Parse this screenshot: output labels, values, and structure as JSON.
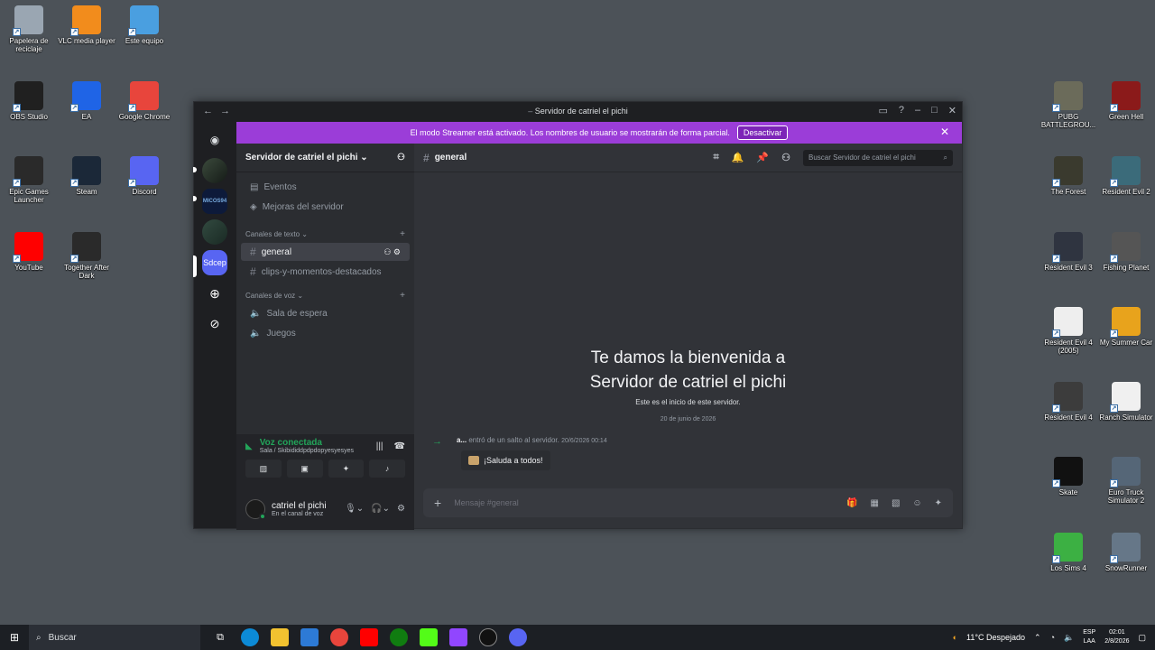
{
  "desktop": {
    "left_icons": [
      {
        "label": "Papelera de reciclaje",
        "icon": "recycle-bin-icon",
        "color": "#9aa6b2"
      },
      {
        "label": "VLC media player",
        "icon": "vlc-icon",
        "color": "#f28c1c"
      },
      {
        "label": "Este equipo",
        "icon": "computer-icon",
        "color": "#4a9fe0"
      },
      {
        "label": "OBS Studio",
        "icon": "obs-icon",
        "color": "#202020"
      },
      {
        "label": "EA",
        "icon": "ea-icon",
        "color": "#1f64e6"
      },
      {
        "label": "Google Chrome",
        "icon": "chrome-icon",
        "color": "#e8453c"
      },
      {
        "label": "Epic Games Launcher",
        "icon": "epic-icon",
        "color": "#2a2a2a"
      },
      {
        "label": "Steam",
        "icon": "steam-icon",
        "color": "#1b2838"
      },
      {
        "label": "Discord",
        "icon": "discord-icon",
        "color": "#5865f2"
      },
      {
        "label": "YouTube",
        "icon": "youtube-icon",
        "color": "#ff0000"
      },
      {
        "label": "Together After Dark",
        "icon": "epic-icon",
        "color": "#2a2a2a"
      }
    ],
    "right_icons": [
      {
        "label": "PUBG BATTLEGROU...",
        "icon": "pubg-icon",
        "color": "#6b6b5a"
      },
      {
        "label": "Green Hell",
        "icon": "green-hell-icon",
        "color": "#8b1a1a"
      },
      {
        "label": "The Forest",
        "icon": "the-forest-icon",
        "color": "#3a3a2e"
      },
      {
        "label": "Resident Evil 2",
        "icon": "re2-icon",
        "color": "#3b6b7a"
      },
      {
        "label": "Resident Evil 3",
        "icon": "re3-icon",
        "color": "#2f3440"
      },
      {
        "label": "Fishing Planet",
        "icon": "fishing-planet-icon",
        "color": "#555"
      },
      {
        "label": "Resident Evil 4 (2005)",
        "icon": "re4-2005-icon",
        "color": "#eee"
      },
      {
        "label": "My Summer Car",
        "icon": "my-summer-car-icon",
        "color": "#e8a31c"
      },
      {
        "label": "Resident Evil 4",
        "icon": "re4-icon",
        "color": "#3c3c3c"
      },
      {
        "label": "Ranch Simulator",
        "icon": "ranch-sim-icon",
        "color": "#f0f0f0"
      },
      {
        "label": "Skate",
        "icon": "skate-icon",
        "color": "#111"
      },
      {
        "label": "Euro Truck Simulator 2",
        "icon": "ets2-icon",
        "color": "#556677"
      },
      {
        "label": "Los Sims 4",
        "icon": "sims-icon",
        "color": "#3cb043"
      },
      {
        "label": "SnowRunner",
        "icon": "snowrunner-icon",
        "color": "#667788"
      }
    ]
  },
  "window": {
    "title": "Servidor de catriel el pichi",
    "streamer_banner": "El modo Streamer está activado. Los nombres de usuario se mostrarán de forma parcial.",
    "streamer_button": "Desactivar",
    "server_initials": "Sdcep",
    "server_label_2": "MICOS94"
  },
  "sidebar": {
    "server_name": "Servidor de catriel el pichi",
    "top_items": [
      {
        "label": "Eventos"
      },
      {
        "label": "Mejoras del servidor"
      }
    ],
    "text_category": "Canales de texto",
    "text_channels": [
      "general",
      "clips-y-momentos-destacados"
    ],
    "voice_category": "Canales de voz",
    "voice_channels": [
      "Sala de espera",
      "Juegos"
    ]
  },
  "voice_panel": {
    "status": "Voz conectada",
    "room": "Sala / Skibididdpdpdopyesyesyes"
  },
  "user_panel": {
    "username": "catriel el pichi",
    "status": "En el canal de voz"
  },
  "main": {
    "channel": "general",
    "search_placeholder": "Buscar Servidor de catriel el pichi",
    "welcome_line1": "Te damos la bienvenida a",
    "welcome_line2": "Servidor de catriel el pichi",
    "welcome_sub": "Este es el inicio de este servidor.",
    "date_divider": "20 de junio de 2026",
    "join_user": "a...",
    "join_text": "entró de un salto al servidor.",
    "join_time": "20/6/2026 00:14",
    "wave_button": "¡Saluda a todos!",
    "composer_placeholder": "Mensaje #general"
  },
  "taskbar": {
    "search": "Buscar",
    "weather": "11°C  Despejado",
    "lang_top": "ESP",
    "lang_bottom": "LAA",
    "time": "02:01",
    "date": "2/8/2026"
  }
}
